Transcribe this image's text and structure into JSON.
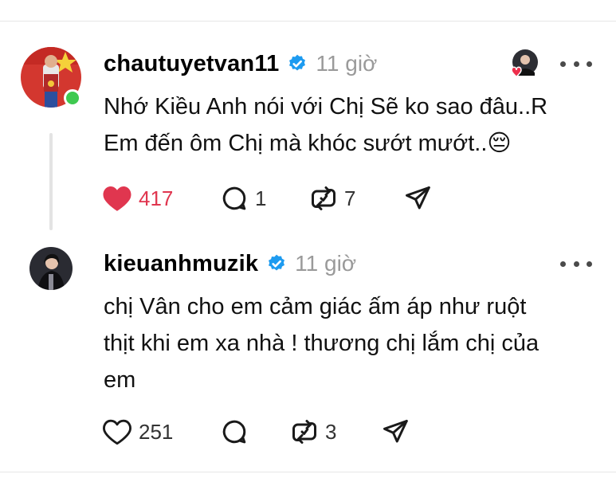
{
  "posts": [
    {
      "username": "chautuyetvan11",
      "time": "11 giờ",
      "lines": [
        "Nhớ Kiều Anh nói với Chị Sẽ ko sao đâu..R",
        "Em đến ôm Chị mà khóc sướt mướt..😔"
      ],
      "likes": "417",
      "liked": true,
      "replies": "1",
      "reposts": "7",
      "colors": {
        "like": "#e0364f"
      }
    },
    {
      "username": "kieuanhmuzik",
      "time": "11 giờ",
      "lines": [
        "chị Vân cho em cảm giác ấm áp như ruột",
        "thịt khi em xa nhà ! thương chị lắm chị của",
        "em"
      ],
      "likes": "251",
      "liked": false,
      "replies": "",
      "reposts": "3"
    }
  ],
  "icons": [
    "verified-badge-icon",
    "heart-icon",
    "comment-icon",
    "repost-icon",
    "share-icon",
    "more-icon"
  ],
  "colors": {
    "verified": "#1d9bf0",
    "online": "#3fc950",
    "muted_text": "#9a9a9a"
  }
}
